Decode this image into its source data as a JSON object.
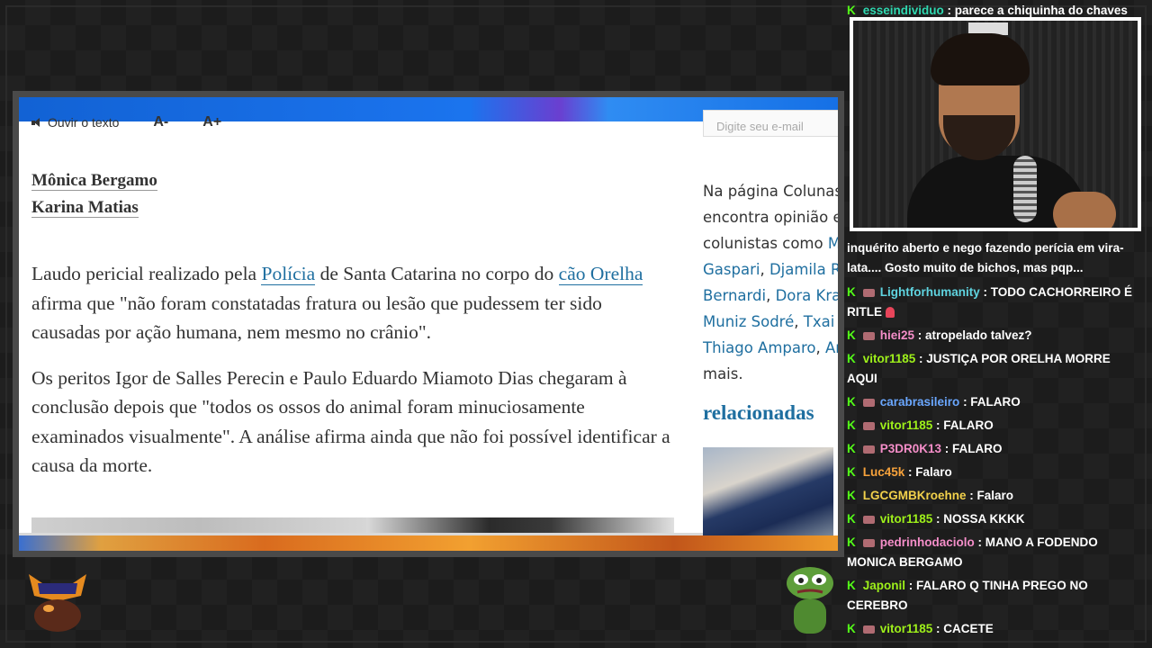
{
  "article": {
    "toolbar": {
      "listen": "Ouvir o texto",
      "font_smaller": "A-",
      "font_larger": "A+"
    },
    "email_placeholder": "Digite seu e-mail",
    "authors": [
      "Mônica Bergamo",
      "Karina Matias"
    ],
    "p1": {
      "t1": "Laudo pericial realizado pela ",
      "link1": "Polícia",
      "t2": " de Santa Catarina no corpo do ",
      "link2": "cão Orelha",
      "t3": " afirma que \"não foram constatadas fratura ou lesão que pudessem ter sido causadas por ação humana, nem mesmo no crânio\"."
    },
    "p2": "Os peritos Igor de Salles Perecin e Paulo Eduardo Miamoto Dias chegaram à conclusão depois que \"todos os ossos do animal foram minuciosamente examinados visualmente\". A análise afirma ainda que não foi possível identificar a causa da morte.",
    "sidebar": {
      "line1": "Na página Colunas",
      "line2": "encontra opinião e",
      "line3": "colunistas como ",
      "line3_link": "Mô",
      "line4_a": "Gaspari",
      "line4_b": "Djamila Ri",
      "line5_a": "Bernardi",
      "line5_b": "Dora Kram",
      "line6_a": "Muniz Sodré",
      "line6_b": "Txai S",
      "line7_a": "Thiago Amparo",
      "line7_b": "An",
      "line8": "mais.",
      "sep": ", "
    },
    "related_heading": "relacionadas"
  },
  "chat": {
    "messages": [
      {
        "user": "esseindividuo",
        "text": " : parece a chiquinha do chaves",
        "color": "#2fd8b0"
      },
      {
        "user": "",
        "text": "inquérito aberto e nego fazendo perícia em vira-lata.... Gosto muito de bichos, mas pqp...",
        "color": "#e9e9e9"
      },
      {
        "user": "Lightforhumanity",
        "text": " : TODO CACHORREIRO É RITLE",
        "color": "#5fd4e0"
      },
      {
        "user": "hiei25",
        "text": " : atropelado talvez?",
        "color": "#f58ec9"
      },
      {
        "user": "vitor1185",
        "text": " : JUSTIÇA POR ORELHA MORRE AQUI",
        "color": "#9ef01a"
      },
      {
        "user": "carabrasileiro",
        "text": " : FALARO",
        "color": "#6aa7ff"
      },
      {
        "user": "vitor1185",
        "text": " : FALARO",
        "color": "#9ef01a"
      },
      {
        "user": "P3DR0K13",
        "text": " : FALARO",
        "color": "#f58ec9"
      },
      {
        "user": "Luc45k",
        "text": " : Falaro",
        "color": "#f7a23b"
      },
      {
        "user": "LGCGMBKroehne",
        "text": " : Falaro",
        "color": "#f2d14b"
      },
      {
        "user": "vitor1185",
        "text": " : NOSSA KKKK",
        "color": "#9ef01a"
      },
      {
        "user": "pedrinhodaciolo",
        "text": " : MANO A FODENDO MONICA BERGAMO",
        "color": "#f58ec9"
      },
      {
        "user": "Japonil",
        "text": " : FALARO Q TINHA PREGO NO CEREBRO",
        "color": "#9ef01a"
      },
      {
        "user": "vitor1185",
        "text": " : CACETE",
        "color": "#9ef01a"
      }
    ]
  },
  "icons": {
    "kick": "kick-k-icon",
    "badge": "subscriber-badge-icon",
    "flag": "red-flag-emoji-icon"
  }
}
